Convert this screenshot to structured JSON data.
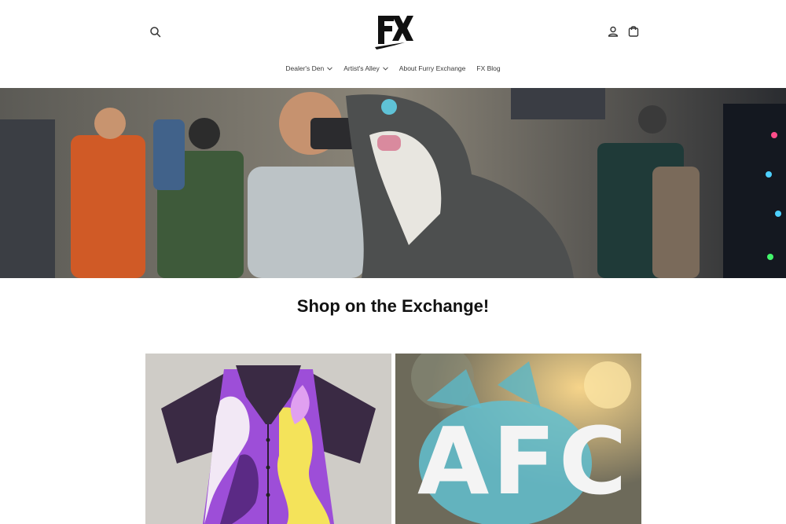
{
  "header": {
    "logo_text": "FX",
    "icons": {
      "search": "search-icon",
      "account": "user-icon",
      "cart": "shopping-bag-icon"
    }
  },
  "nav": {
    "items": [
      {
        "label": "Dealer's Den",
        "has_dropdown": true
      },
      {
        "label": "Artist's Alley",
        "has_dropdown": true
      },
      {
        "label": "About Furry Exchange",
        "has_dropdown": false
      },
      {
        "label": "FX Blog",
        "has_dropdown": false
      }
    ]
  },
  "main": {
    "heading": "Shop on the Exchange!",
    "collections": [
      {
        "image": "shirt-product-image"
      },
      {
        "image_text": "AFC"
      }
    ]
  }
}
